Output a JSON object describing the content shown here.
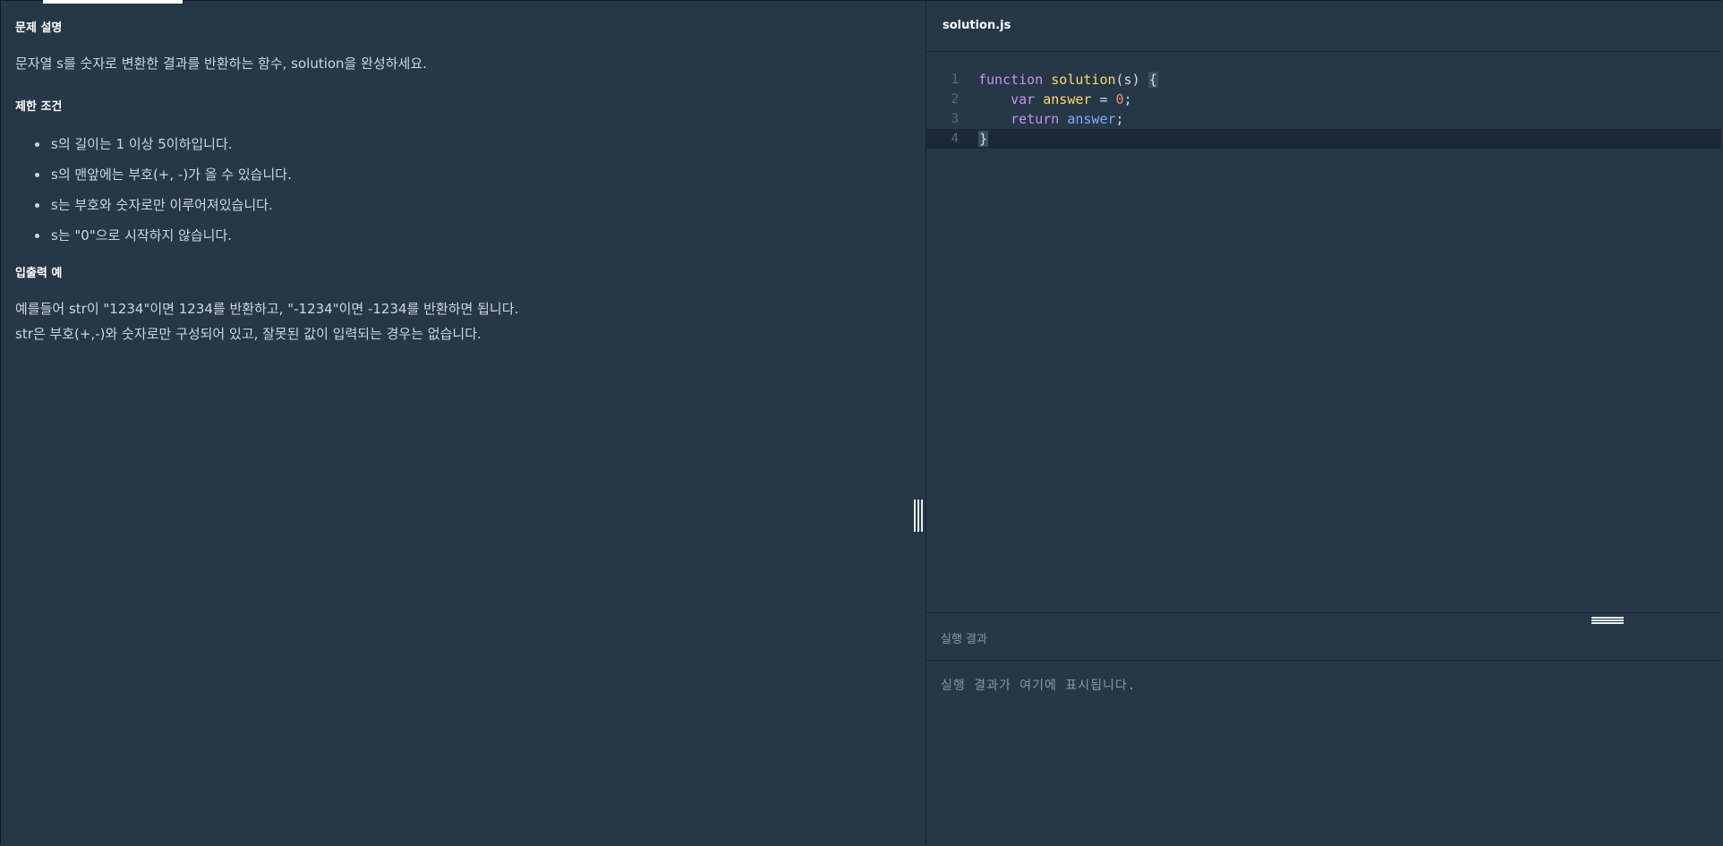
{
  "problem": {
    "description_title": "문제 설명",
    "description_text": "문자열 s를 숫자로 변환한 결과를 반환하는 함수, solution을 완성하세요.",
    "constraints_title": "제한 조건",
    "constraints": [
      "s의 길이는 1 이상 5이하입니다.",
      "s의 맨앞에는 부호(+, -)가 올 수 있습니다.",
      "s는 부호와 숫자로만 이루어져있습니다.",
      "s는 \"0\"으로 시작하지 않습니다."
    ],
    "examples_title": "입출력 예",
    "examples_lines": [
      "예를들어 str이 \"1234\"이면 1234를 반환하고, \"-1234\"이면 -1234를 반환하면 됩니다.",
      "str은 부호(+,-)와 숫자로만 구성되어 있고, 잘못된 값이 입력되는 경우는 없습니다."
    ]
  },
  "editor": {
    "file_name": "solution.js",
    "line_numbers": [
      "1",
      "2",
      "3",
      "4"
    ],
    "code": {
      "l1_kw": "function",
      "l1_fn": "solution",
      "l1_rest": "(s) ",
      "l1_brace": "{",
      "l2_kw": "var",
      "l2_var": "answer",
      "l2_eq": " = ",
      "l2_num": "0",
      "l2_end": ";",
      "l3_kw": "return",
      "l3_ret": "answer",
      "l3_end": ";",
      "l4_brace": "}"
    }
  },
  "result": {
    "title": "실행 결과",
    "placeholder": "실행 결과가 여기에 표시됩니다."
  }
}
